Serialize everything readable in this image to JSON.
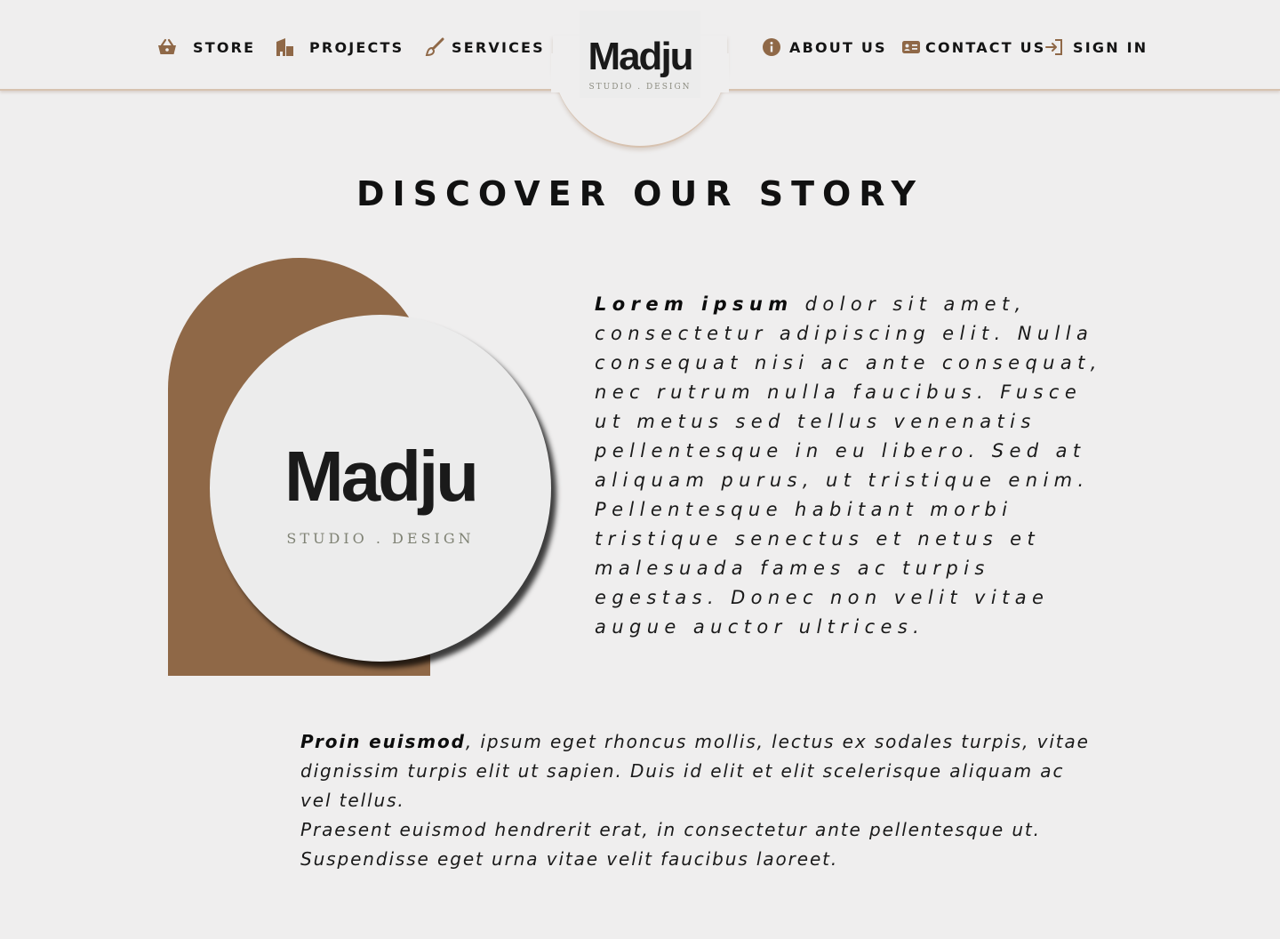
{
  "brand": {
    "name": "Madju",
    "tagline": "STUDIO . DESIGN"
  },
  "nav": {
    "store": "STORE",
    "projects": "PROJECTS",
    "services": "SERVICES",
    "about": "ABOUT US",
    "contact": "CONTACT US",
    "signin": "SIGN IN"
  },
  "icons": [
    "basket-icon",
    "building-icon",
    "brush-icon",
    "info-icon",
    "contact-card-icon",
    "sign-in-icon"
  ],
  "colors": {
    "accent": "#8f6847",
    "background": "#efeeee",
    "border": "#d7c2b0"
  },
  "main": {
    "title": "DISCOVER OUR STORY",
    "story_lead": "Lorem ipsum",
    "story_body": " dolor sit amet, consectetur adipiscing elit. Nulla consequat nisi ac ante consequat, nec rutrum nulla faucibus. Fusce ut metus sed tellus venenatis pellentesque in eu libero. Sed at aliquam purus, ut tristique enim. Pellentesque habitant morbi tristique senectus et netus et malesuada fames ac turpis egestas. Donec non velit vitae augue auctor ultrices.",
    "para1_lead": "Proin euismod",
    "para1_body": ", ipsum eget rhoncus mollis, lectus ex sodales turpis, vitae dignissim turpis elit ut sapien. Duis id elit et elit scelerisque aliquam ac vel tellus.",
    "para2": "Praesent euismod hendrerit erat, in consectetur ante pellentesque ut. Suspendisse eget urna vitae velit faucibus laoreet."
  }
}
